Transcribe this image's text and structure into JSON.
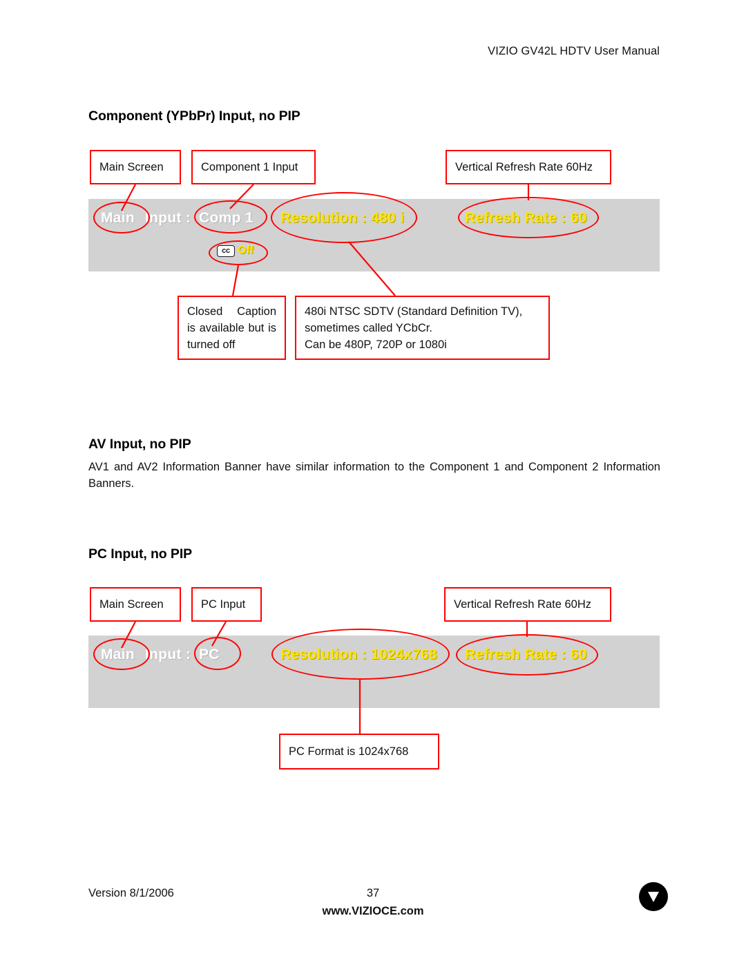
{
  "document": {
    "header": "VIZIO GV42L HDTV User Manual",
    "footer": {
      "version": "Version 8/1/2006",
      "page_number": "37",
      "website": "www.VIZIOCE.com",
      "logo_letter": "V"
    }
  },
  "colors": {
    "callout_border": "#ff0000",
    "banner_background": "#d2d2d2",
    "osd_label": "#ffffff",
    "osd_value": "#ffe400"
  },
  "sections": {
    "component": {
      "heading": "Component (YPbPr) Input, no PIP",
      "callouts": {
        "main_screen": "Main Screen",
        "input": "Component 1 Input",
        "refresh": "Vertical Refresh Rate 60Hz",
        "closed_caption": "Closed Caption is available but is turned off",
        "resolution_note_line1": "480i NTSC SDTV (Standard Definition TV),",
        "resolution_note_line2": "sometimes called YCbCr.",
        "resolution_note_line3": "Can be 480P, 720P or 1080i"
      },
      "banner": {
        "main_label": "Main",
        "input_label": "Input :",
        "input_value": "Comp 1",
        "resolution": "Resolution : 480 i",
        "refresh_rate": "Refresh Rate : 60",
        "cc_icon": "cc",
        "cc_state": "Off"
      }
    },
    "av": {
      "heading": "AV Input, no PIP",
      "paragraph": "AV1 and AV2 Information Banner have similar information to the Component 1 and Component 2 Information Banners."
    },
    "pc": {
      "heading": "PC Input, no PIP",
      "callouts": {
        "main_screen": "Main Screen",
        "input": "PC Input",
        "refresh": "Vertical Refresh Rate 60Hz",
        "format_note": "PC Format is 1024x768"
      },
      "banner": {
        "main_label": "Main",
        "input_label": "Input :",
        "input_value": "PC",
        "resolution": "Resolution : 1024x768",
        "refresh_rate": "Refresh Rate : 60"
      }
    }
  }
}
